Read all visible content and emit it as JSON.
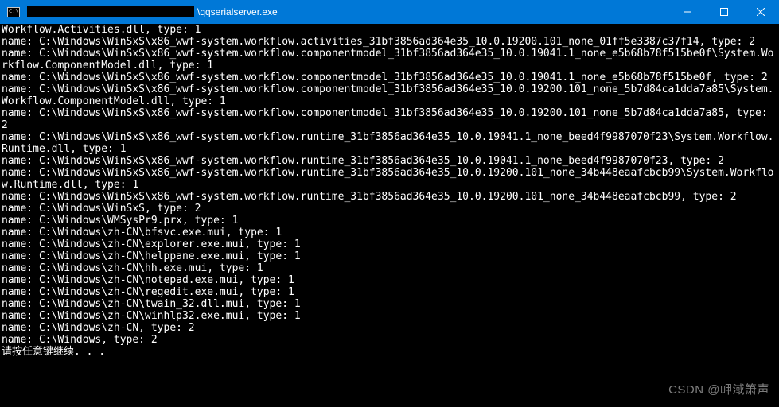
{
  "titlebar": {
    "visible_title": "\\qqserialserver.exe"
  },
  "buttons": {
    "minimize": "Minimize",
    "maximize": "Maximize",
    "close": "Close"
  },
  "console_lines": [
    "Workflow.Activities.dll, type: 1",
    "name: C:\\Windows\\WinSxS\\x86_wwf-system.workflow.activities_31bf3856ad364e35_10.0.19200.101_none_01ff5e3387c37f14, type: 2",
    "name: C:\\Windows\\WinSxS\\x86_wwf-system.workflow.componentmodel_31bf3856ad364e35_10.0.19041.1_none_e5b68b78f515be0f\\System.Workflow.ComponentModel.dll, type: 1",
    "name: C:\\Windows\\WinSxS\\x86_wwf-system.workflow.componentmodel_31bf3856ad364e35_10.0.19041.1_none_e5b68b78f515be0f, type: 2",
    "name: C:\\Windows\\WinSxS\\x86_wwf-system.workflow.componentmodel_31bf3856ad364e35_10.0.19200.101_none_5b7d84ca1dda7a85\\System.Workflow.ComponentModel.dll, type: 1",
    "name: C:\\Windows\\WinSxS\\x86_wwf-system.workflow.componentmodel_31bf3856ad364e35_10.0.19200.101_none_5b7d84ca1dda7a85, type: 2",
    "name: C:\\Windows\\WinSxS\\x86_wwf-system.workflow.runtime_31bf3856ad364e35_10.0.19041.1_none_beed4f9987070f23\\System.Workflow.Runtime.dll, type: 1",
    "name: C:\\Windows\\WinSxS\\x86_wwf-system.workflow.runtime_31bf3856ad364e35_10.0.19041.1_none_beed4f9987070f23, type: 2",
    "name: C:\\Windows\\WinSxS\\x86_wwf-system.workflow.runtime_31bf3856ad364e35_10.0.19200.101_none_34b448eaafcbcb99\\System.Workflow.Runtime.dll, type: 1",
    "name: C:\\Windows\\WinSxS\\x86_wwf-system.workflow.runtime_31bf3856ad364e35_10.0.19200.101_none_34b448eaafcbcb99, type: 2",
    "name: C:\\Windows\\WinSxS, type: 2",
    "name: C:\\Windows\\WMSysPr9.prx, type: 1",
    "name: C:\\Windows\\zh-CN\\bfsvc.exe.mui, type: 1",
    "name: C:\\Windows\\zh-CN\\explorer.exe.mui, type: 1",
    "name: C:\\Windows\\zh-CN\\helppane.exe.mui, type: 1",
    "name: C:\\Windows\\zh-CN\\hh.exe.mui, type: 1",
    "name: C:\\Windows\\zh-CN\\notepad.exe.mui, type: 1",
    "name: C:\\Windows\\zh-CN\\regedit.exe.mui, type: 1",
    "name: C:\\Windows\\zh-CN\\twain_32.dll.mui, type: 1",
    "name: C:\\Windows\\zh-CN\\winhlp32.exe.mui, type: 1",
    "name: C:\\Windows\\zh-CN, type: 2",
    "name: C:\\Windows, type: 2",
    "请按任意键继续. . . "
  ],
  "watermark": "CSDN @岬淢箫声"
}
